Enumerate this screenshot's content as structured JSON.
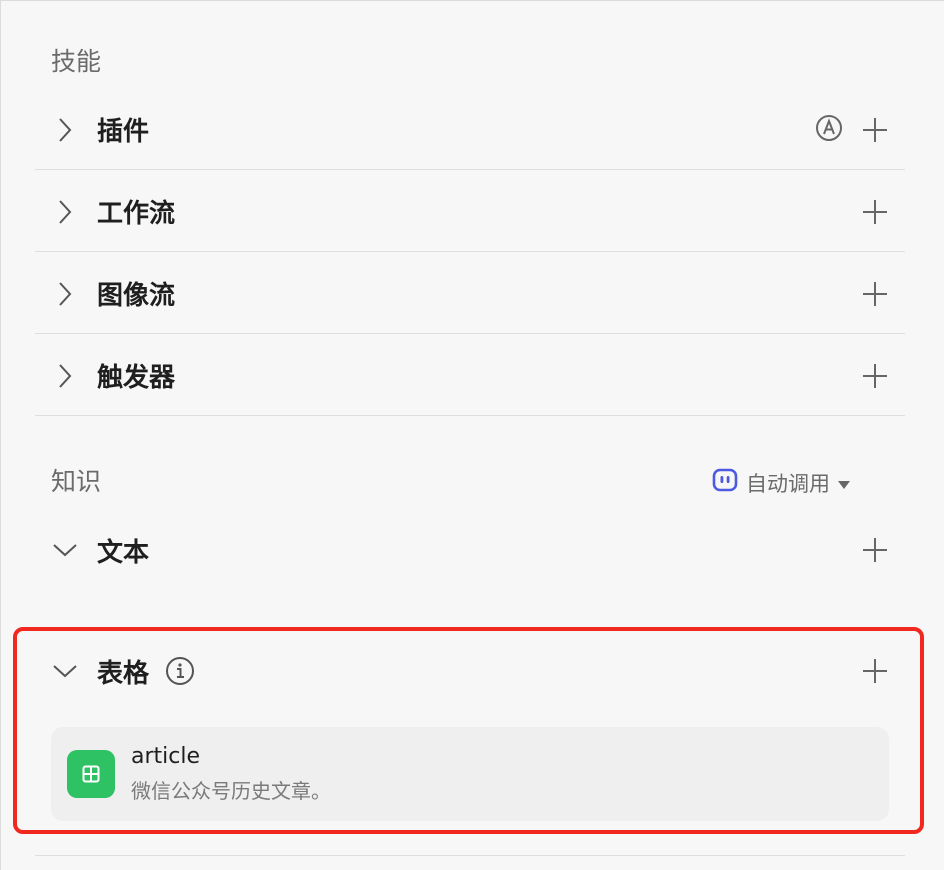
{
  "skills": {
    "title": "技能",
    "items": [
      {
        "label": "插件"
      },
      {
        "label": "工作流"
      },
      {
        "label": "图像流"
      },
      {
        "label": "触发器"
      }
    ]
  },
  "knowledge": {
    "title": "知识",
    "auto_mode": "自动调用",
    "text_label": "文本",
    "table_label": "表格",
    "table_item": {
      "name": "article",
      "description": "微信公众号历史文章。"
    }
  },
  "colors": {
    "accent": "#4b5ae0",
    "table_icon": "#2fc265",
    "highlight": "#f0281e"
  }
}
